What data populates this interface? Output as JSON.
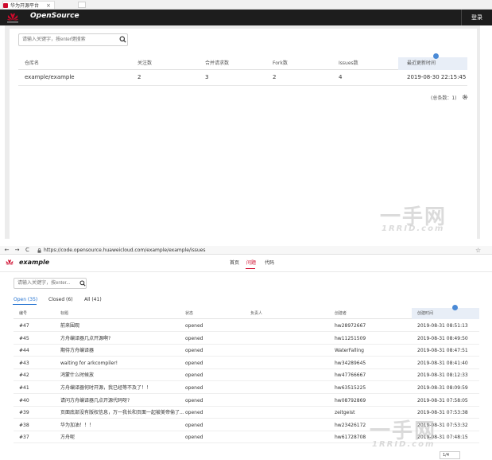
{
  "top": {
    "browser": {
      "tab_title": "华为开源平台",
      "close": "×"
    },
    "header": {
      "brand": "OpenSource",
      "login": "登录"
    },
    "search": {
      "placeholder": "请输入关键字，按enter键搜索"
    },
    "table": {
      "columns": [
        "仓库名",
        "关注数",
        "合并请求数",
        "Fork数",
        "Issues数",
        "最近更新时间"
      ],
      "row": [
        "example/example",
        "2",
        "3",
        "2",
        "4",
        "2019-08-30 22:15:45"
      ]
    },
    "total": "(总条数：1)",
    "watermark": {
      "big": "一手网",
      "small": "1RRID.com"
    }
  },
  "bottom": {
    "browser": {
      "back": "←",
      "forward": "→",
      "reload": "C",
      "url": "https://code.opensource.huaweicloud.com/example/example/issues",
      "star": "☆"
    },
    "header": {
      "project": "example",
      "nav": [
        "首页",
        "问题",
        "代码"
      ]
    },
    "search": {
      "placeholder": "请输入关键字，按enter..."
    },
    "tabs": [
      "Open (35)",
      "Closed (6)",
      "All (41)"
    ],
    "table": {
      "columns": [
        "编号",
        "标题",
        "状态",
        "负责人",
        "创建者",
        "创建时间"
      ],
      "rows": [
        [
          "#47",
          "前来围观",
          "opened",
          "hw28972667",
          "2019-08-31 08:51:13"
        ],
        [
          "#45",
          "方舟编译器几点开源啊?",
          "opened",
          "hw11251509",
          "2019-08-31 08:49:50"
        ],
        [
          "#44",
          "期待方舟编译器",
          "opened",
          "WaterFalling",
          "2019-08-31 08:47:51"
        ],
        [
          "#43",
          "waiting for arkcompiler!",
          "opened",
          "hw34289645",
          "2019-08-31 08:41:40"
        ],
        [
          "#42",
          "鸿蒙什么时候放",
          "opened",
          "hw47766667",
          "2019-08-31 08:12:33"
        ],
        [
          "#41",
          "方舟编译器何时开源，我已经等不及了！！",
          "opened",
          "hw63515225",
          "2019-08-31 08:09:59"
        ],
        [
          "#40",
          "请问方舟编译器几点开源代码呀?",
          "opened",
          "hw08792869",
          "2019-08-31 07:58:05"
        ],
        [
          "#39",
          "页面底部没有版权信息，万一我长和页面一起被美帝偷了...",
          "opened",
          "zeitgeist",
          "2019-08-31 07:53:38"
        ],
        [
          "#38",
          "华为加油！！！",
          "opened",
          "hw23426172",
          "2019-08-31 07:53:32"
        ],
        [
          "#37",
          "方舟呢",
          "opened",
          "hw61728708",
          "2019-08-31 07:48:15"
        ]
      ]
    },
    "pager": "1/4",
    "watermark": {
      "big": "一手网",
      "small": "1RRID.com"
    }
  },
  "colors": {
    "accent": "#cf0a2c",
    "link": "#1e6fd0",
    "dark_header": "#1d1d1d"
  }
}
